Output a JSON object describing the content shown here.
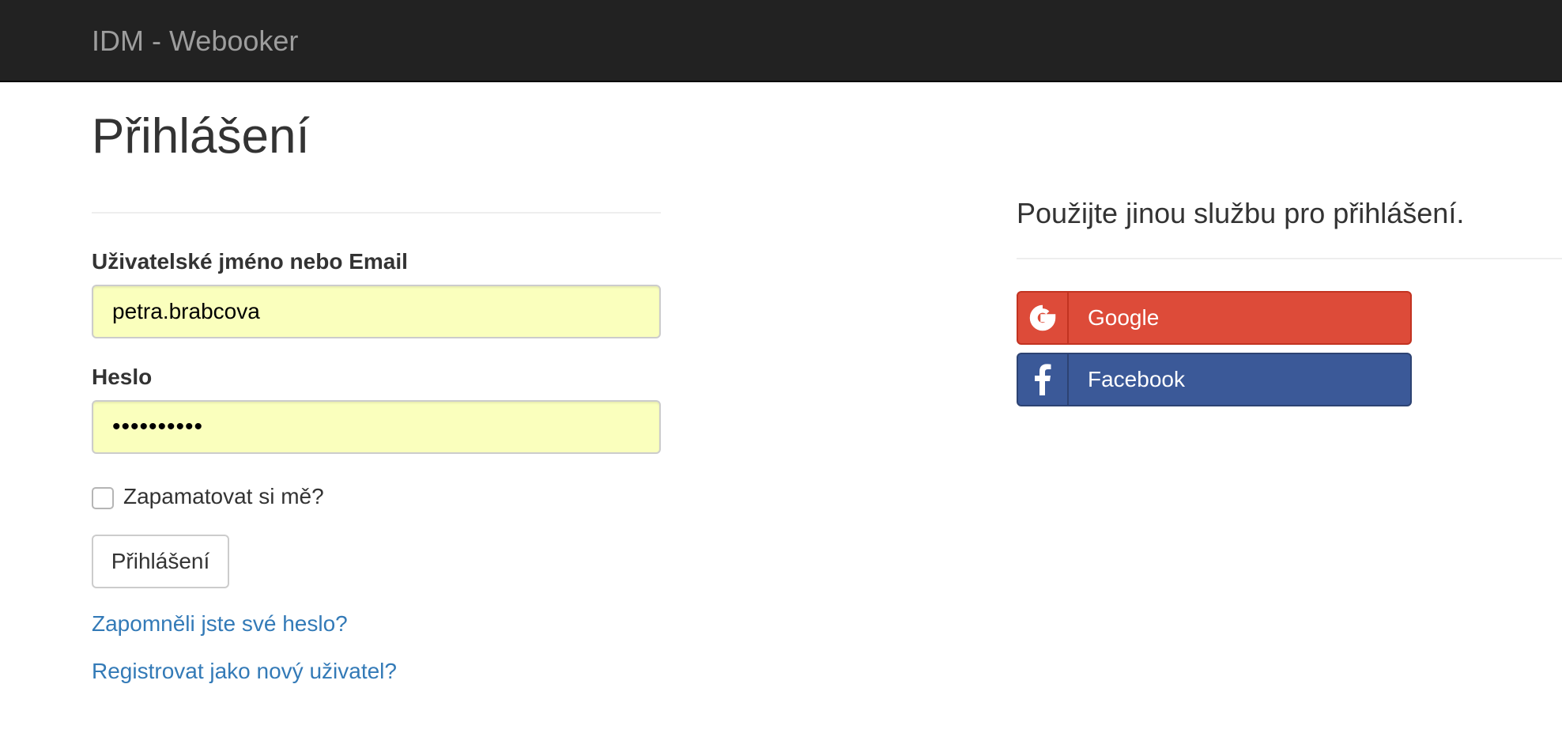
{
  "navbar": {
    "brand": "IDM - Webooker"
  },
  "page": {
    "title": "Přihlášení"
  },
  "form": {
    "username_label": "Uživatelské jméno nebo Email",
    "username_value": "petra.brabcova",
    "password_label": "Heslo",
    "password_value": "••••••••••",
    "remember_label": "Zapamatovat si mě?",
    "remember_checked": false,
    "submit_label": "Přihlášení",
    "forgot_link": "Zapomněli jste své heslo?",
    "register_link": "Registrovat jako nový uživatel?"
  },
  "external": {
    "title": "Použijte jinou službu pro přihlášení.",
    "providers": [
      {
        "label": "Google",
        "icon": "google-icon",
        "color": "#dd4b39"
      },
      {
        "label": "Facebook",
        "icon": "facebook-icon",
        "color": "#3b5998"
      }
    ]
  },
  "colors": {
    "navbar_bg": "#222222",
    "brand_text": "#9d9d9d",
    "link": "#337ab7",
    "autofill_bg": "#faffbd"
  }
}
